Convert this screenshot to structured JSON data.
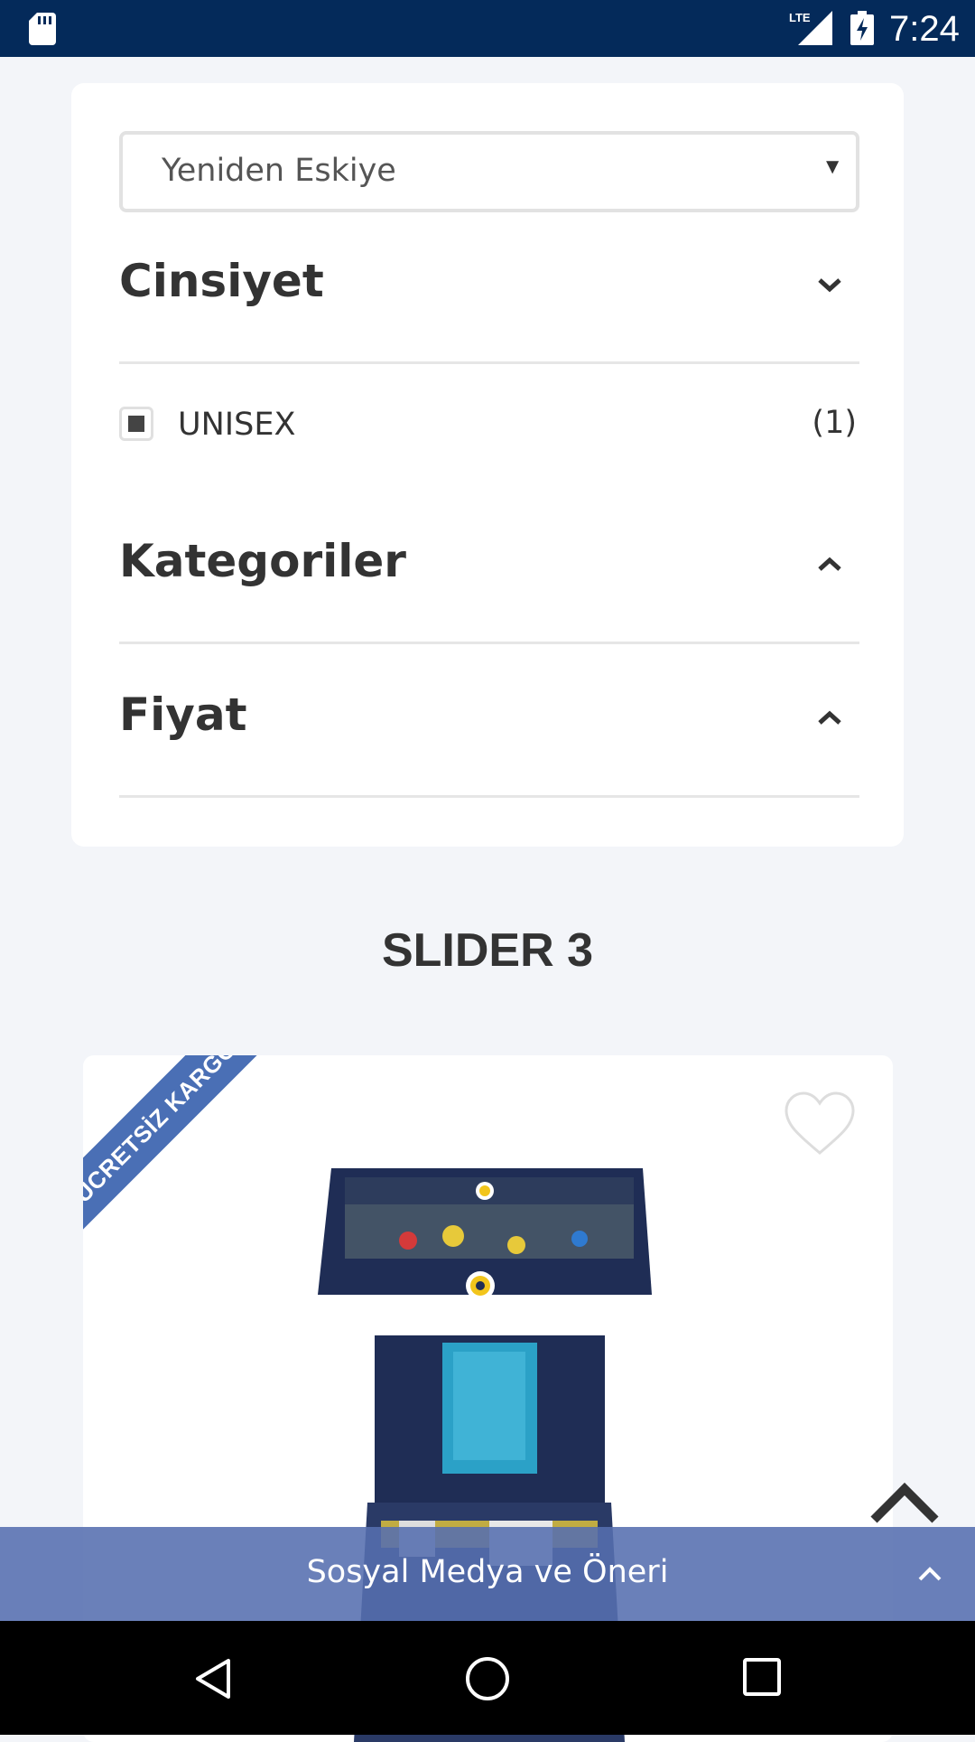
{
  "status_bar": {
    "time": "7:24",
    "network": "LTE",
    "icons": [
      "sd-card-icon",
      "lte-signal-icon",
      "battery-charging-icon"
    ]
  },
  "filters": {
    "sort": {
      "selected": "Yeniden Eskiye"
    },
    "sections": [
      {
        "title": "Cinsiyet",
        "state": "expanded",
        "options": [
          {
            "label": "UNISEX",
            "count": "(1)",
            "checked": true
          }
        ]
      },
      {
        "title": "Kategoriler",
        "state": "collapsed"
      },
      {
        "title": "Fiyat",
        "state": "collapsed"
      }
    ]
  },
  "slider": {
    "title": "SLIDER 3"
  },
  "product": {
    "ribbon": "ÜCRETSİZ KARGO",
    "ribbon_color": "#4a6fb5",
    "favorite_icon": "heart-outline-icon",
    "image": "basketball-boxed-set-image"
  },
  "bottom_bar": {
    "label": "Sosyal Medya ve Öneri",
    "color": "#556eaf"
  },
  "nav_bar": {
    "icons": [
      "back-icon",
      "home-icon",
      "recent-apps-icon"
    ]
  },
  "colors": {
    "status_bar": "#042a5a",
    "page_background": "#f3f5f9"
  }
}
